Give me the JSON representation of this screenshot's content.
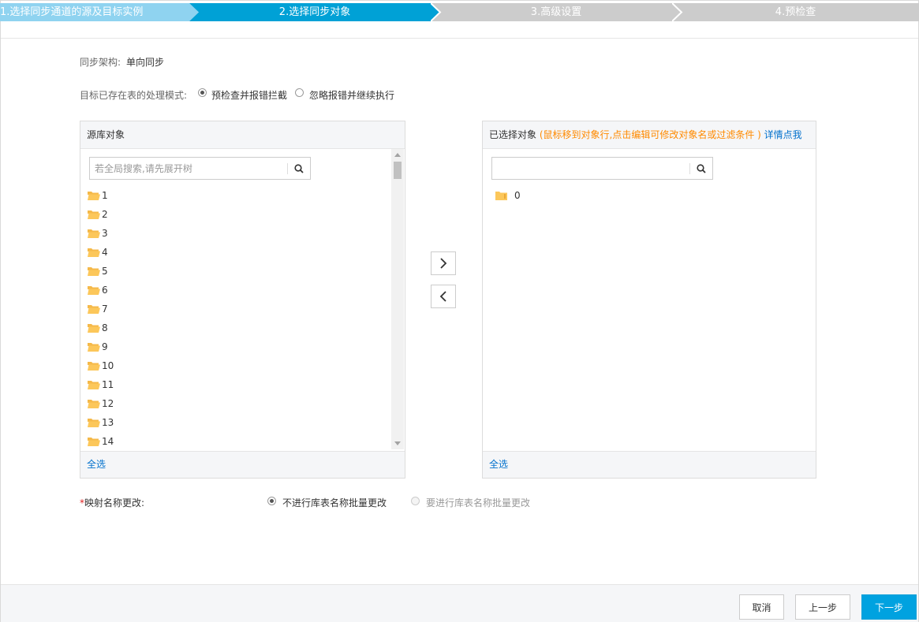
{
  "steps": [
    {
      "label": "1.选择同步通道的源及目标实例",
      "state": "done"
    },
    {
      "label": "2.选择同步对象",
      "state": "active"
    },
    {
      "label": "3.高级设置",
      "state": "todo"
    },
    {
      "label": "4.预检查",
      "state": "todo"
    }
  ],
  "colors": {
    "done": "#8fd3f0",
    "active": "#00a1d6",
    "todo": "#cccccc",
    "primary": "#00a2e0",
    "link": "#0070cc",
    "hint": "#ff8a00"
  },
  "sync_arch": {
    "label": "同步架构:",
    "value": "单向同步"
  },
  "existing_table_mode": {
    "label": "目标已存在表的处理模式:",
    "options": [
      {
        "label": "预检查并报错拦截",
        "checked": true
      },
      {
        "label": "忽略报错并继续执行",
        "checked": false
      }
    ]
  },
  "source_panel": {
    "title": "源库对象",
    "search_placeholder": "若全局搜索,请先展开树",
    "items": [
      "1",
      "2",
      "3",
      "4",
      "5",
      "6",
      "7",
      "8",
      "9",
      "10",
      "11",
      "12",
      "13",
      "14"
    ],
    "select_all": "全选"
  },
  "selected_panel": {
    "title": "已选择对象",
    "hint": "(鼠标移到对象行,点击编辑可修改对象名或过滤条件 )",
    "detail_link": "详情点我",
    "search_placeholder": "",
    "items": [
      "0"
    ],
    "select_all": "全选"
  },
  "mapping": {
    "required_mark": "*",
    "label": "映射名称更改:",
    "options": [
      {
        "label": "不进行库表名称批量更改",
        "checked": true,
        "disabled": false
      },
      {
        "label": "要进行库表名称批量更改",
        "checked": false,
        "disabled": true
      }
    ]
  },
  "footer": {
    "cancel": "取消",
    "prev": "上一步",
    "next": "下一步"
  }
}
